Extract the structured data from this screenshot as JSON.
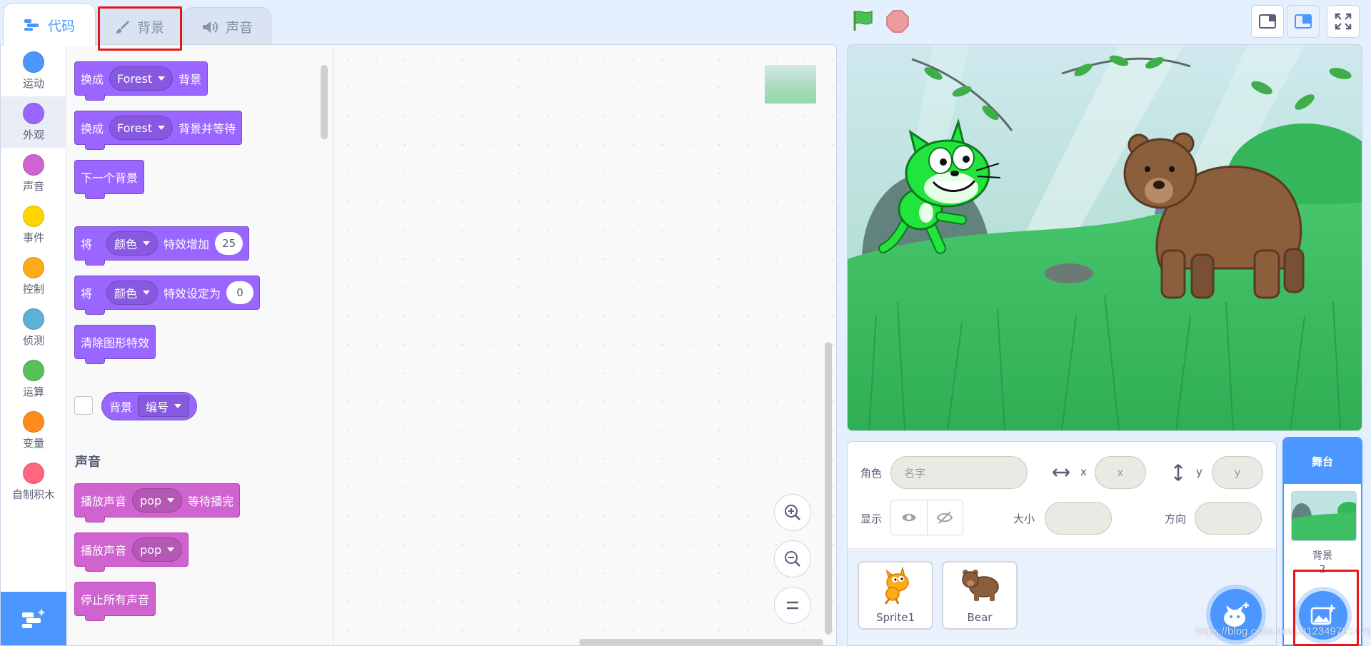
{
  "tabs": [
    {
      "label": "代码",
      "icon": "code-icon",
      "active": true
    },
    {
      "label": "背景",
      "icon": "brush-icon",
      "active": false
    },
    {
      "label": "声音",
      "icon": "speaker-icon",
      "active": false
    }
  ],
  "categories": [
    {
      "label": "运动",
      "color": "#4c97ff"
    },
    {
      "label": "外观",
      "color": "#9966ff"
    },
    {
      "label": "声音",
      "color": "#cf63cf"
    },
    {
      "label": "事件",
      "color": "#ffd500"
    },
    {
      "label": "控制",
      "color": "#ffab19"
    },
    {
      "label": "侦测",
      "color": "#5cb1d6"
    },
    {
      "label": "运算",
      "color": "#59c059"
    },
    {
      "label": "变量",
      "color": "#ff8c1a"
    },
    {
      "label": "自制积木",
      "color": "#ff6680"
    }
  ],
  "blocks": {
    "switch_backdrop": {
      "prefix": "换成",
      "value": "Forest",
      "suffix": "背景"
    },
    "switch_backdrop_wait": {
      "prefix": "换成",
      "value": "Forest",
      "suffix": "背景并等待"
    },
    "next_backdrop": {
      "label": "下一个背景"
    },
    "change_effect": {
      "prefix": "将",
      "value": "颜色",
      "middle": "特效增加",
      "number": "25"
    },
    "set_effect": {
      "prefix": "将",
      "value": "颜色",
      "middle": "特效设定为",
      "number": "0"
    },
    "clear_effects": {
      "label": "清除图形特效"
    },
    "backdrop_reporter": {
      "label": "背景",
      "value": "编号"
    },
    "sound_heading": "声音",
    "play_until_done": {
      "prefix": "播放声音",
      "value": "pop",
      "suffix": "等待播完"
    },
    "start_sound": {
      "prefix": "播放声音",
      "value": "pop"
    },
    "stop_all_sounds": {
      "label": "停止所有声音"
    }
  },
  "sprite_info": {
    "sprite_label": "角色",
    "name_placeholder": "名字",
    "x_label": "x",
    "x_placeholder": "x",
    "y_label": "y",
    "y_placeholder": "y",
    "show_label": "显示",
    "size_label": "大小",
    "direction_label": "方向"
  },
  "sprites": [
    {
      "name": "Sprite1",
      "icon": "cat-sprite-icon"
    },
    {
      "name": "Bear",
      "icon": "bear-sprite-icon"
    }
  ],
  "stage_pane": {
    "title": "舞台",
    "backdrops_label": "背景",
    "backdrops_count": "2"
  },
  "watermark": "https://blog.csdn.net/u012349781478"
}
